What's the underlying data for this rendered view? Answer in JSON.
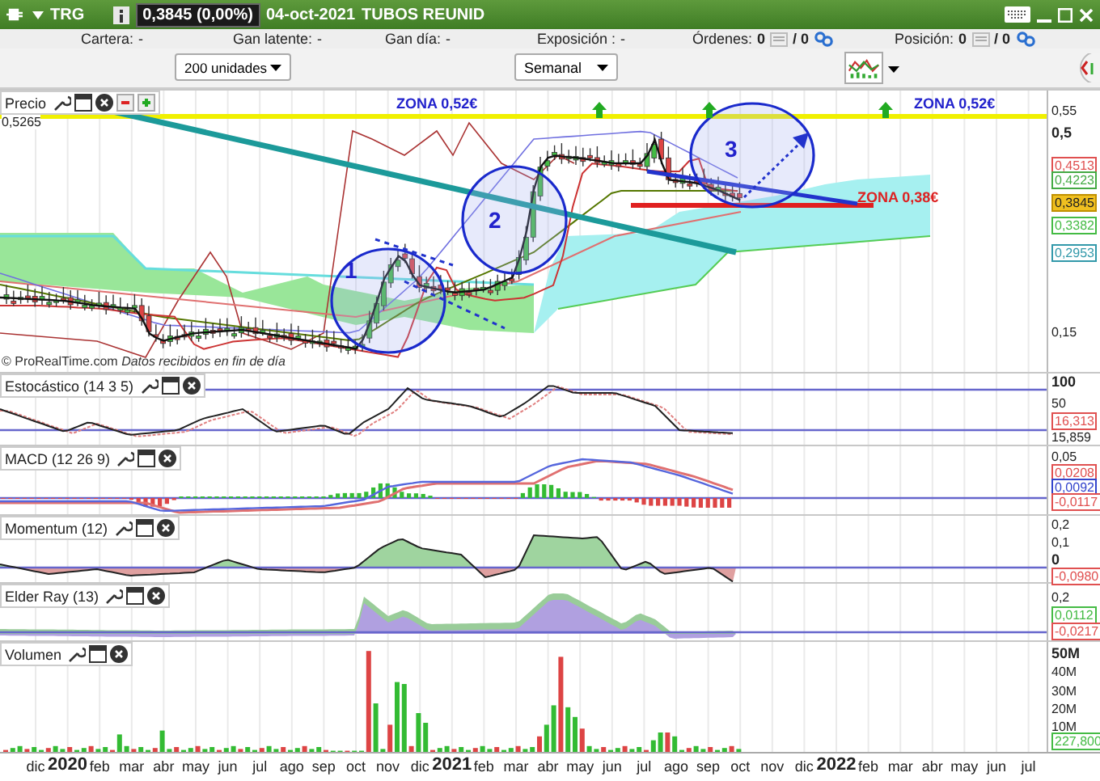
{
  "header": {
    "symbol": "TRG",
    "quote": "0,3845 (0,00%)",
    "date": "04-oct-2021",
    "name": "TUBOS REUNID"
  },
  "info": [
    {
      "label": "Cartera:",
      "value": "-",
      "kind": "plain"
    },
    {
      "label": "Gan latente:",
      "value": "-",
      "kind": "plain"
    },
    {
      "label": "Gan día:",
      "value": "-",
      "kind": "plain"
    },
    {
      "label": "Exposición :",
      "value": "-",
      "kind": "plain"
    },
    {
      "label": "Órdenes:",
      "value": "0",
      "extra": "/ 0",
      "kind": "count"
    },
    {
      "label": "Posición:",
      "value": "0",
      "extra": "/ 0",
      "kind": "count"
    }
  ],
  "toolbar": {
    "quantity": "200 unidades",
    "period": "Semanal"
  },
  "price_panel": {
    "title": "Precio",
    "top_value": "0,5265",
    "footer": "© ProRealTime.com *Datos recibidos en fin de día*",
    "annotations": [
      {
        "text": "ZONA 0,52€",
        "kind": "zone",
        "color": "#2222cc"
      },
      {
        "text": "ZONA 0,52€",
        "kind": "zone",
        "color": "#2222cc"
      },
      {
        "text": "ZONA 0,38€",
        "kind": "zone",
        "color": "#dd2222"
      },
      {
        "text": "1",
        "kind": "number",
        "color": "#2222cc"
      },
      {
        "text": "2",
        "kind": "number",
        "color": "#2222cc"
      },
      {
        "text": "3",
        "kind": "number",
        "color": "#2222cc"
      }
    ],
    "axis": [
      {
        "text": "0,55",
        "kind": "plain"
      },
      {
        "text": "0,5",
        "kind": "bold"
      },
      {
        "text": "0,4513",
        "kind": "tag",
        "color": "#e05050"
      },
      {
        "text": "0,4223",
        "kind": "tag",
        "color": "#44aa44"
      },
      {
        "text": "0,3845",
        "kind": "current",
        "color": "#f0c020"
      },
      {
        "text": "0,3382",
        "kind": "tag",
        "color": "#44bb44"
      },
      {
        "text": "0,2953",
        "kind": "tag",
        "color": "#3399aa"
      },
      {
        "text": "0,15",
        "kind": "plain"
      }
    ]
  },
  "indicators": [
    {
      "title": "Estocástico (14 3 5)",
      "kind": "stochastic",
      "axis": [
        {
          "text": "100",
          "kind": "bold"
        },
        {
          "text": "50",
          "kind": "plain"
        },
        {
          "text": "16,313",
          "kind": "tag",
          "color": "#e05050"
        },
        {
          "text": "15,859",
          "kind": "plain"
        }
      ]
    },
    {
      "title": "MACD (12 26 9)",
      "kind": "macd",
      "axis": [
        {
          "text": "0,05",
          "kind": "plain"
        },
        {
          "text": "0,0208",
          "kind": "tag",
          "color": "#e05050"
        },
        {
          "text": "0,0092",
          "kind": "tag",
          "color": "#3344cc"
        },
        {
          "text": "-0,0117",
          "kind": "tag",
          "color": "#e05050"
        }
      ]
    },
    {
      "title": "Momentum (12)",
      "kind": "momentum",
      "axis": [
        {
          "text": "0,2",
          "kind": "plain"
        },
        {
          "text": "0,1",
          "kind": "plain"
        },
        {
          "text": "0",
          "kind": "bold"
        },
        {
          "text": "-0,0980",
          "kind": "tag",
          "color": "#e05050"
        }
      ]
    },
    {
      "title": "Elder Ray (13)",
      "kind": "elder",
      "axis": [
        {
          "text": "0,2",
          "kind": "plain"
        },
        {
          "text": "0,0112",
          "kind": "tag",
          "color": "#44bb44"
        },
        {
          "text": "-0,0217",
          "kind": "tag",
          "color": "#e05050"
        }
      ]
    },
    {
      "title": "Volumen",
      "kind": "volume",
      "axis": [
        {
          "text": "50M",
          "kind": "bold"
        },
        {
          "text": "40M",
          "kind": "plain"
        },
        {
          "text": "30M",
          "kind": "plain"
        },
        {
          "text": "20M",
          "kind": "plain"
        },
        {
          "text": "10M",
          "kind": "plain"
        },
        {
          "text": "227,800",
          "kind": "tag",
          "color": "#44bb44"
        }
      ]
    }
  ],
  "x_axis": [
    {
      "label": "dic",
      "kind": "month"
    },
    {
      "label": "2020",
      "kind": "year"
    },
    {
      "label": "feb",
      "kind": "month"
    },
    {
      "label": "mar",
      "kind": "month"
    },
    {
      "label": "abr",
      "kind": "month"
    },
    {
      "label": "may",
      "kind": "month"
    },
    {
      "label": "jun",
      "kind": "month"
    },
    {
      "label": "jul",
      "kind": "month"
    },
    {
      "label": "ago",
      "kind": "month"
    },
    {
      "label": "sep",
      "kind": "month"
    },
    {
      "label": "oct",
      "kind": "month"
    },
    {
      "label": "nov",
      "kind": "month"
    },
    {
      "label": "dic",
      "kind": "month"
    },
    {
      "label": "2021",
      "kind": "year"
    },
    {
      "label": "feb",
      "kind": "month"
    },
    {
      "label": "mar",
      "kind": "month"
    },
    {
      "label": "abr",
      "kind": "month"
    },
    {
      "label": "may",
      "kind": "month"
    },
    {
      "label": "jun",
      "kind": "month"
    },
    {
      "label": "jul",
      "kind": "month"
    },
    {
      "label": "ago",
      "kind": "month"
    },
    {
      "label": "sep",
      "kind": "month"
    },
    {
      "label": "oct",
      "kind": "month"
    },
    {
      "label": "nov",
      "kind": "month"
    },
    {
      "label": "dic",
      "kind": "month"
    },
    {
      "label": "2022",
      "kind": "year"
    },
    {
      "label": "feb",
      "kind": "month"
    },
    {
      "label": "mar",
      "kind": "month"
    },
    {
      "label": "abr",
      "kind": "month"
    },
    {
      "label": "may",
      "kind": "month"
    },
    {
      "label": "jun",
      "kind": "month"
    },
    {
      "label": "jul",
      "kind": "month"
    }
  ]
}
